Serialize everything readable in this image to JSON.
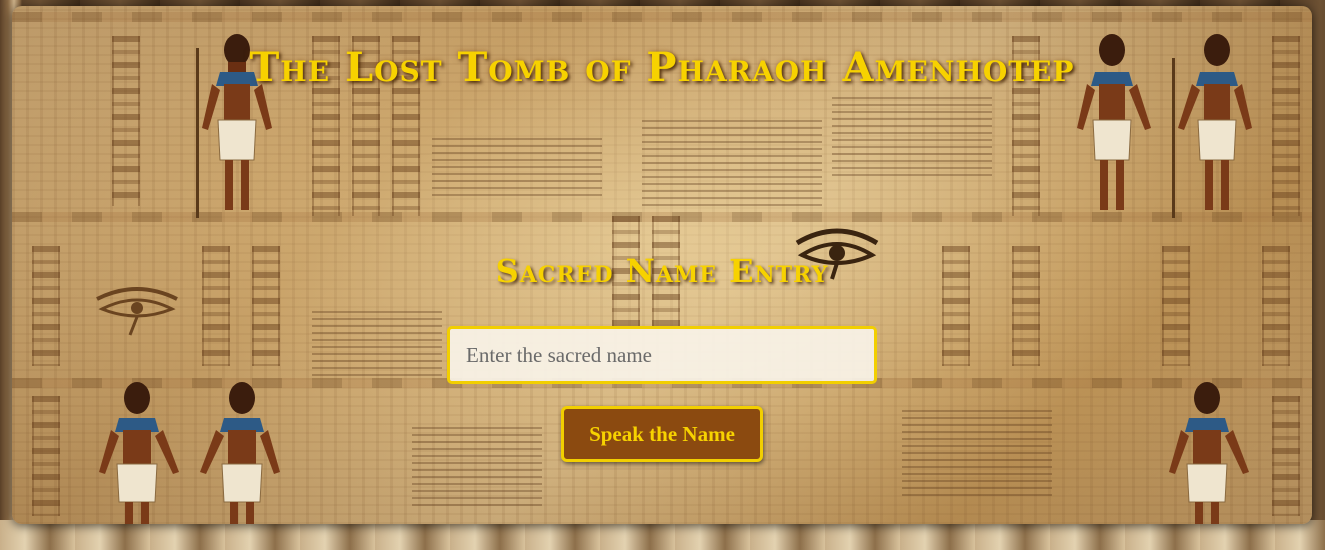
{
  "page": {
    "title": "The Lost Tomb of Pharaoh Amenhotep",
    "subtitle": "Sacred Name Entry"
  },
  "form": {
    "name_placeholder": "Enter the sacred name",
    "name_value": "",
    "submit_label": "Speak the Name"
  },
  "decorations": {
    "figure_icon": "egyptian-figure-icon",
    "eye_icon": "eye-of-horus-icon"
  },
  "colors": {
    "accent_gold": "#f7d200",
    "button_brown": "#8b4a10",
    "papyrus": "#d2b07a"
  }
}
